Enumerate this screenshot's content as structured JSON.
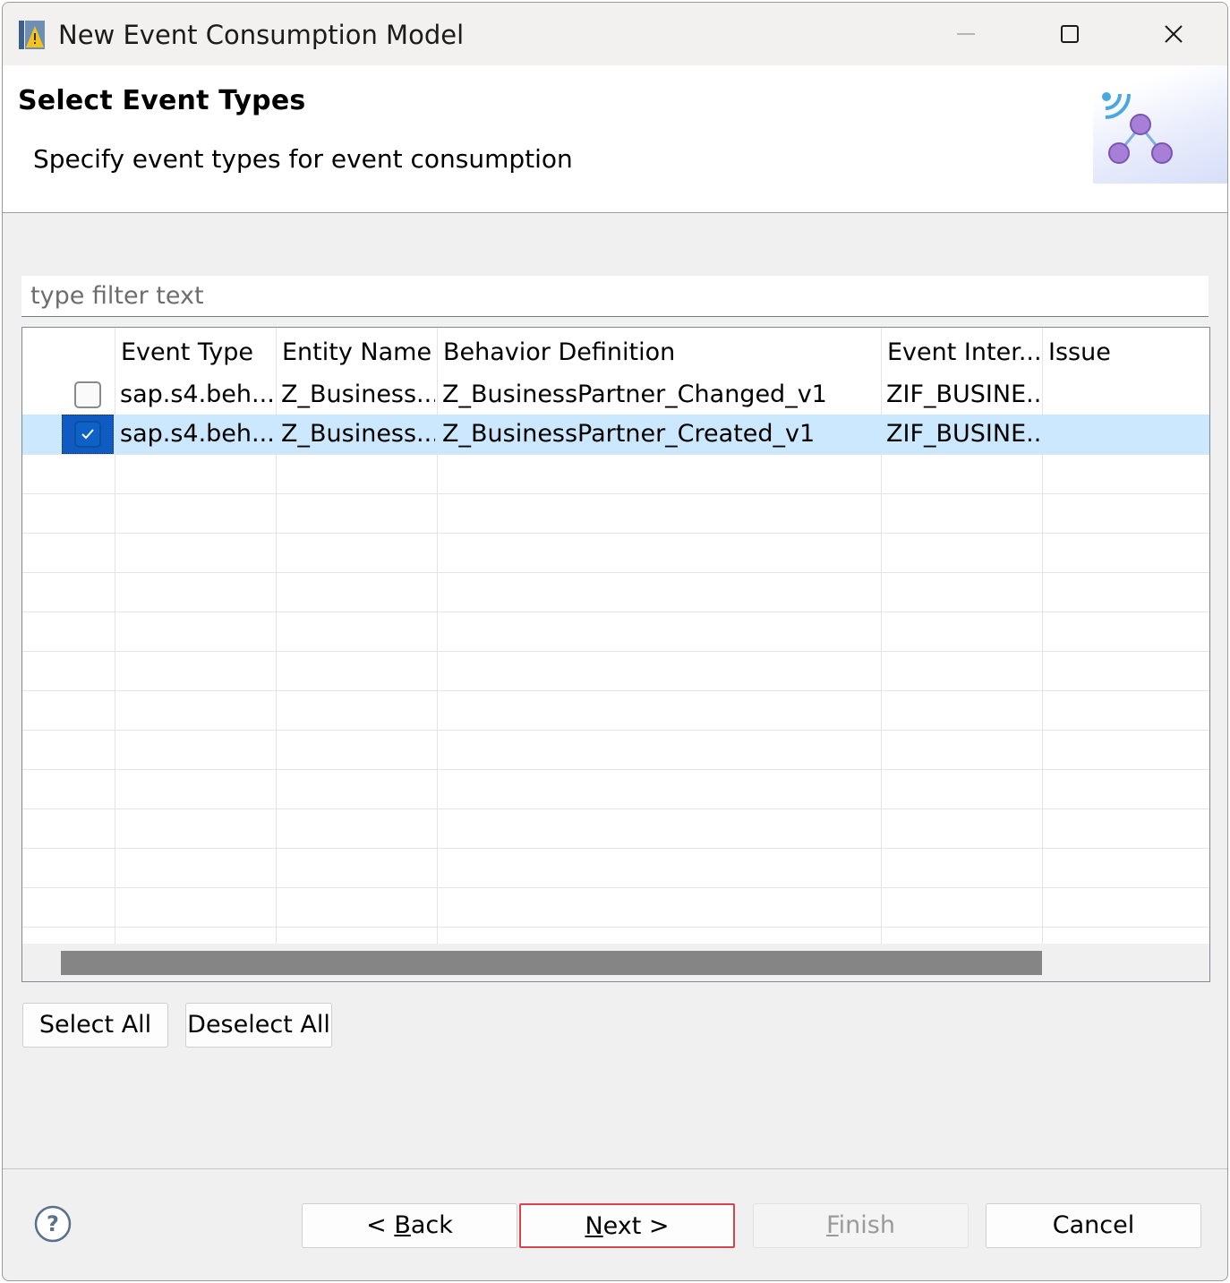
{
  "window": {
    "title": "New Event Consumption Model",
    "controls": [
      "minimize-icon",
      "maximize-icon",
      "close-icon"
    ]
  },
  "header": {
    "title": "Select Event Types",
    "description": "Specify event types for event consumption",
    "graphic": "event-network-icon"
  },
  "filter": {
    "placeholder": "type filter text",
    "value": ""
  },
  "table": {
    "columns": [
      "",
      "Event Type",
      "Entity Name",
      "Behavior Definition",
      "Event Inter...",
      "Issue"
    ],
    "rows": [
      {
        "checked": false,
        "selected": false,
        "event_type": "sap.s4.beh....",
        "entity_name": "Z_Business...",
        "behavior_definition": "Z_BusinessPartner_Changed_v1",
        "event_interface": "ZIF_BUSINE...",
        "issue": ""
      },
      {
        "checked": true,
        "selected": true,
        "event_type": "sap.s4.beh....",
        "entity_name": "Z_Business...",
        "behavior_definition": "Z_BusinessPartner_Created_v1",
        "event_interface": "ZIF_BUSINE...",
        "issue": ""
      }
    ]
  },
  "selection_buttons": {
    "select_all": "Select All",
    "deselect_all": "Deselect All"
  },
  "footer": {
    "help_icon": "help-icon",
    "back": {
      "prefix": "< ",
      "mnemonic": "B",
      "rest": "ack"
    },
    "next": {
      "mnemonic": "N",
      "rest": "ext >"
    },
    "finish": {
      "mnemonic": "F",
      "rest": "inish",
      "enabled": false
    },
    "cancel": "Cancel"
  },
  "colors": {
    "selection": "#cce8ff",
    "checkbox_checked": "#0e62c6",
    "highlight_border": "#d9434e"
  }
}
